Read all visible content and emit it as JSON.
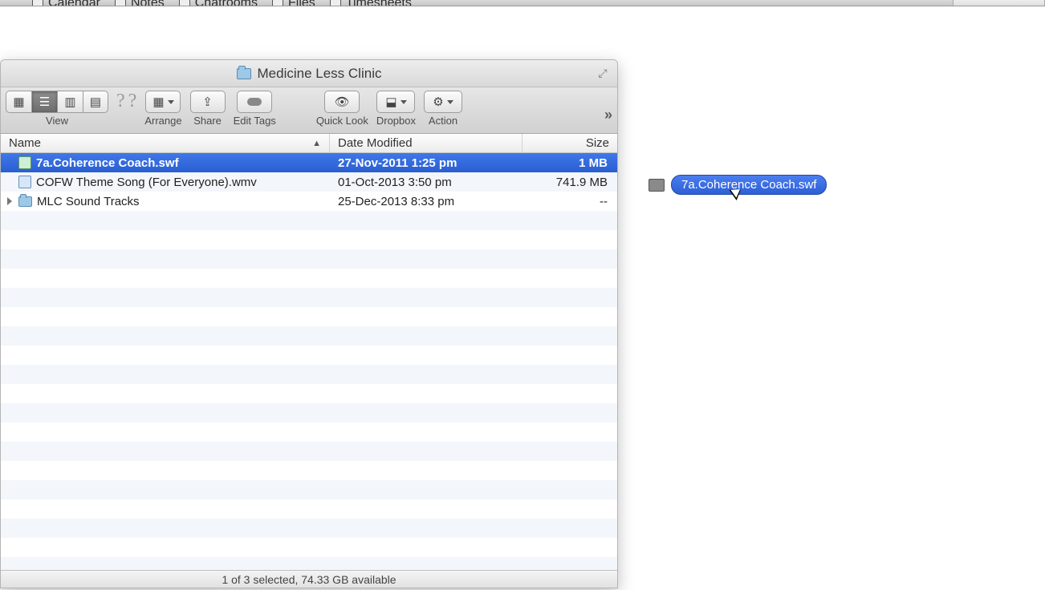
{
  "menubar": {
    "items": [
      {
        "label": "Calendar"
      },
      {
        "label": "Notes"
      },
      {
        "label": "Chatrooms"
      },
      {
        "label": "Files"
      },
      {
        "label": "Timesheets"
      }
    ]
  },
  "window": {
    "title": "Medicine Less Clinic"
  },
  "toolbar": {
    "view_label": "View",
    "arrange_label": "Arrange",
    "share_label": "Share",
    "edit_tags_label": "Edit Tags",
    "quick_look_label": "Quick Look",
    "dropbox_label": "Dropbox",
    "action_label": "Action"
  },
  "columns": {
    "name": "Name",
    "date": "Date Modified",
    "size": "Size"
  },
  "files": [
    {
      "name": "7a.Coherence Coach.swf",
      "date": "27-Nov-2011 1:25 pm",
      "size": "1 MB",
      "kind": "swf",
      "selected": true,
      "is_folder": false
    },
    {
      "name": "COFW Theme Song (For Everyone).wmv",
      "date": "01-Oct-2013 3:50 pm",
      "size": "741.9 MB",
      "kind": "wmv",
      "selected": false,
      "is_folder": false
    },
    {
      "name": "MLC Sound Tracks",
      "date": "25-Dec-2013 8:33 pm",
      "size": "--",
      "kind": "folder",
      "selected": false,
      "is_folder": true
    }
  ],
  "status": "1 of 3 selected, 74.33 GB available",
  "drag": {
    "label": "7a.Coherence Coach.swf"
  }
}
